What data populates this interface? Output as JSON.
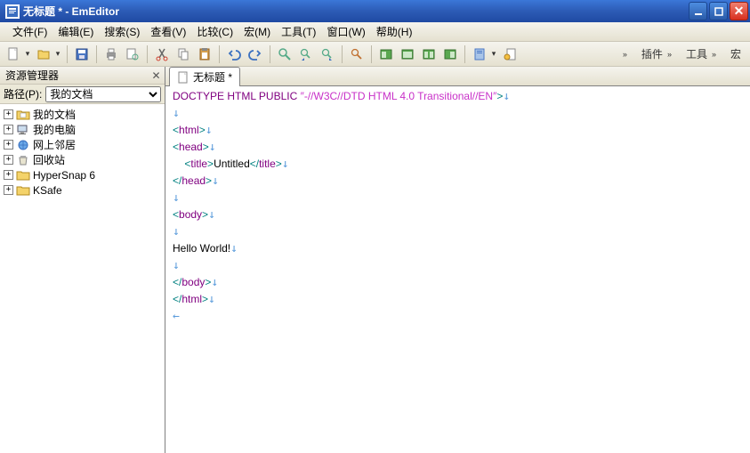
{
  "window": {
    "title": "无标题 * - EmEditor"
  },
  "menu": {
    "file": {
      "label": "文件",
      "hotkey": "(F)"
    },
    "edit": {
      "label": "编辑",
      "hotkey": "(E)"
    },
    "search": {
      "label": "搜索",
      "hotkey": "(S)"
    },
    "view": {
      "label": "查看",
      "hotkey": "(V)"
    },
    "compare": {
      "label": "比较",
      "hotkey": "(C)"
    },
    "macro": {
      "label": "宏",
      "hotkey": "(M)"
    },
    "tools": {
      "label": "工具",
      "hotkey": "(T)"
    },
    "window": {
      "label": "窗口",
      "hotkey": "(W)"
    },
    "help": {
      "label": "帮助",
      "hotkey": "(H)"
    }
  },
  "sidebar": {
    "title": "资源管理器",
    "path_label": "路径(P):",
    "path_value": "我的文档",
    "items": [
      {
        "label": "我的文档",
        "icon": "docs"
      },
      {
        "label": "我的电脑",
        "icon": "computer"
      },
      {
        "label": "网上邻居",
        "icon": "network"
      },
      {
        "label": "回收站",
        "icon": "recycle"
      },
      {
        "label": "HyperSnap 6",
        "icon": "folder"
      },
      {
        "label": "KSafe",
        "icon": "folder"
      }
    ]
  },
  "tabs": [
    {
      "label": "无标题 *"
    }
  ],
  "right_toolbar": {
    "plugins": "插件",
    "tools": "工具",
    "macro": "宏"
  },
  "document": {
    "lines": [
      {
        "t": "doctype",
        "pre": "<!",
        "tag": "DOCTYPE HTML PUBLIC",
        "str": " \"-//W3C//DTD HTML 4.0 Transitional//EN\"",
        "post": ">"
      },
      {
        "t": "blank"
      },
      {
        "t": "tag",
        "open": "html"
      },
      {
        "t": "tag",
        "open": "head"
      },
      {
        "t": "inline",
        "indent": "    ",
        "open": "title",
        "text": "Untitled",
        "close": "title"
      },
      {
        "t": "tag",
        "close": "head"
      },
      {
        "t": "blank"
      },
      {
        "t": "tag",
        "open": "body"
      },
      {
        "t": "blank"
      },
      {
        "t": "text",
        "text": "Hello World!"
      },
      {
        "t": "blank"
      },
      {
        "t": "tag",
        "close": "body"
      },
      {
        "t": "tag",
        "close": "html"
      },
      {
        "t": "eof"
      }
    ]
  }
}
